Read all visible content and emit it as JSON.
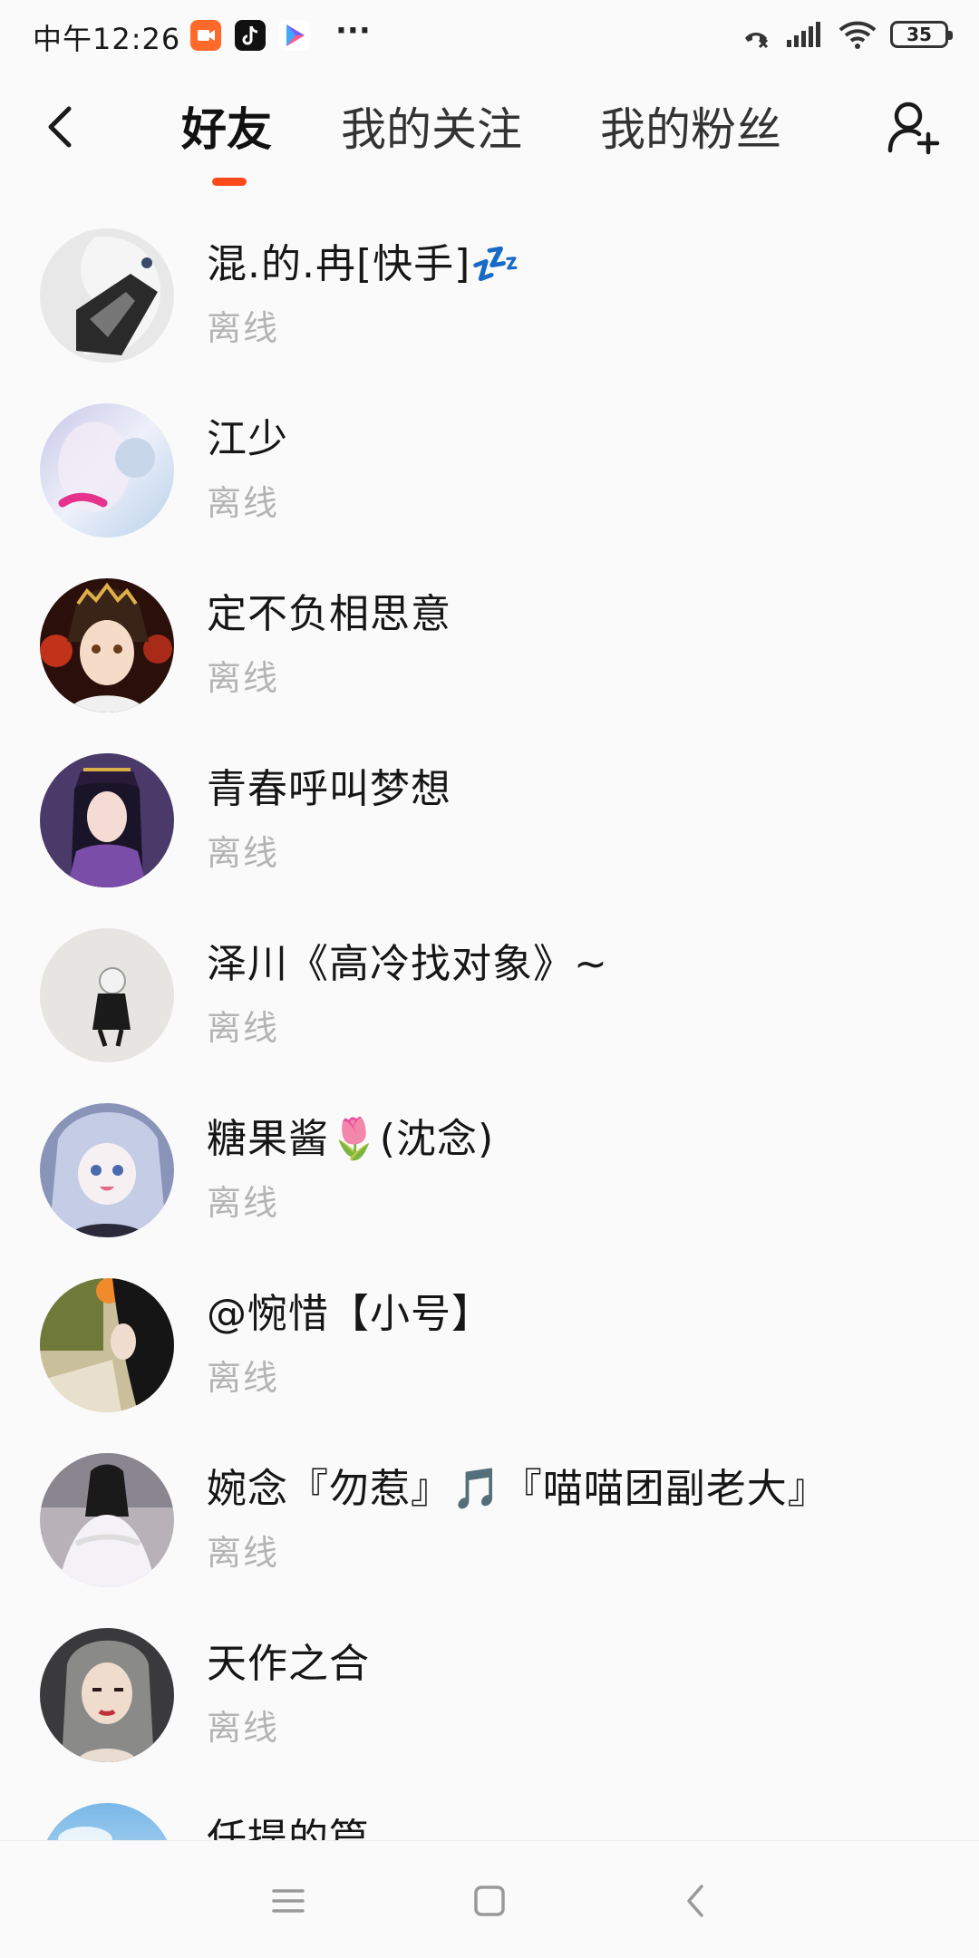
{
  "status_bar": {
    "time": "中午12:26",
    "battery": "35",
    "app_icons": [
      "video-app-icon",
      "tiktok-icon",
      "play-store-icon"
    ],
    "overflow": "···"
  },
  "header": {
    "tabs": [
      {
        "label": "好友",
        "active": true
      },
      {
        "label": "我的关注",
        "active": false
      },
      {
        "label": "我的粉丝",
        "active": false
      }
    ],
    "accent_color": "#fe4a1b"
  },
  "friends": [
    {
      "name": "混.的.冉[快手]💤",
      "status": "离线"
    },
    {
      "name": "江少",
      "status": "离线"
    },
    {
      "name": "定不负相思意",
      "status": "离线"
    },
    {
      "name": "青春呼叫梦想",
      "status": "离线"
    },
    {
      "name": "泽川《高冷找对象》~",
      "status": "离线"
    },
    {
      "name": "糖果酱🌷(沈念)",
      "status": "离线"
    },
    {
      "name": "@惋惜【小号】",
      "status": "离线"
    },
    {
      "name": "婉念『勿惹』🎵『喵喵团副老大』",
      "status": "离线"
    },
    {
      "name": "天作之合",
      "status": "离线"
    },
    {
      "name": "任提的篇",
      "status": ""
    }
  ]
}
